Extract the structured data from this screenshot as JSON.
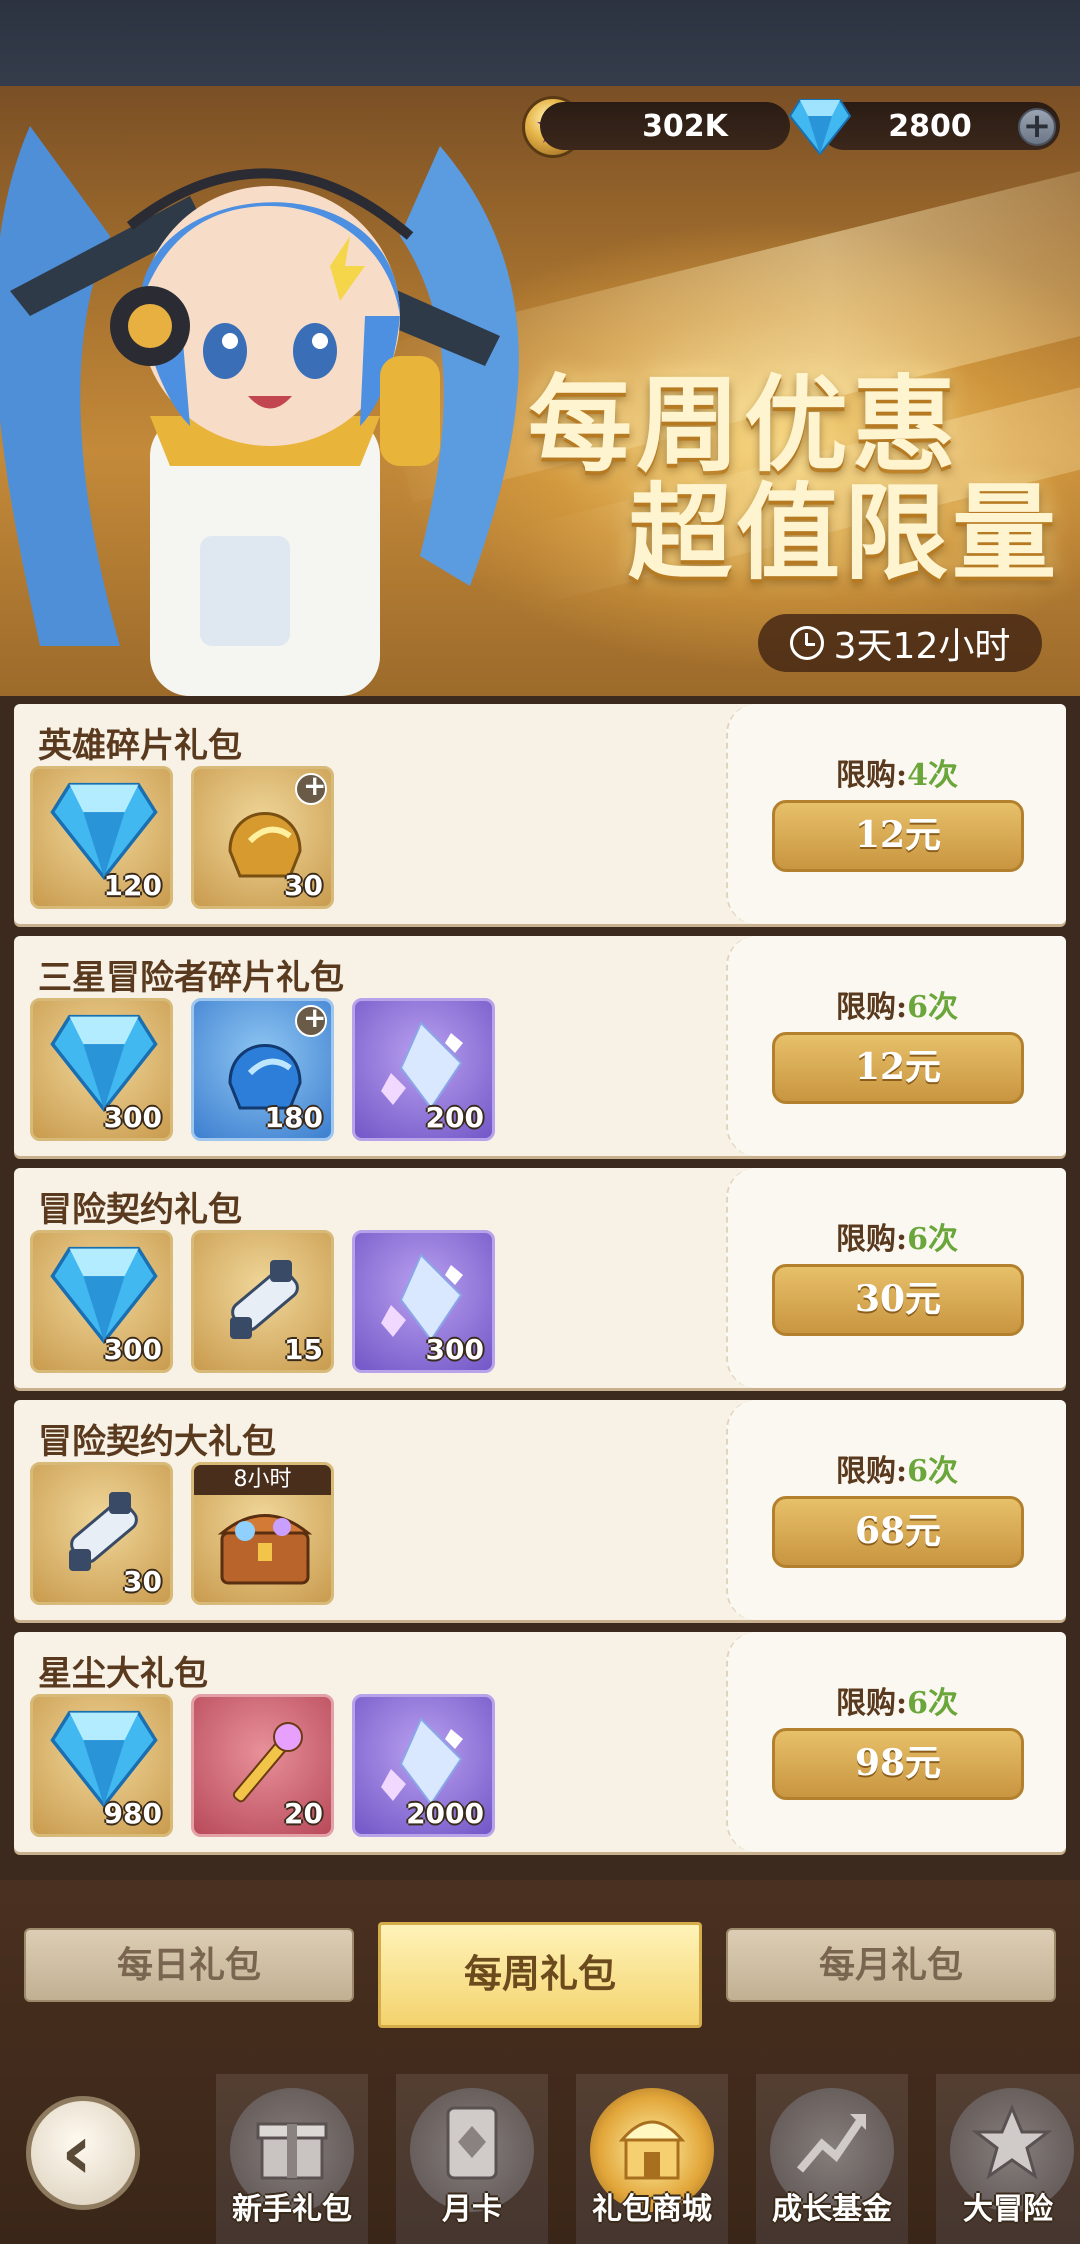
{
  "currency": {
    "gold": "302K",
    "gems": "2800",
    "add_label": "+"
  },
  "banner": {
    "line1": "每周优惠",
    "line2": "超值限量",
    "timer": "3天12小时"
  },
  "packs": [
    {
      "name": "英雄碎片礼包",
      "limit_label": "限购:",
      "limit_count": "4次",
      "price": "12元",
      "items": [
        {
          "icon": "diamond-icon",
          "qty": "120"
        },
        {
          "icon": "hero-helmet-gold-icon",
          "qty": "30"
        }
      ]
    },
    {
      "name": "三星冒险者碎片礼包",
      "limit_label": "限购:",
      "limit_count": "6次",
      "price": "12元",
      "items": [
        {
          "icon": "diamond-icon",
          "qty": "300"
        },
        {
          "icon": "hero-helmet-blue-icon",
          "qty": "180"
        },
        {
          "icon": "crystal-shards-icon",
          "qty": "200"
        }
      ]
    },
    {
      "name": "冒险契约礼包",
      "limit_label": "限购:",
      "limit_count": "6次",
      "price": "30元",
      "items": [
        {
          "icon": "diamond-icon",
          "qty": "300"
        },
        {
          "icon": "contract-scroll-icon",
          "qty": "15"
        },
        {
          "icon": "crystal-shards-icon",
          "qty": "300"
        }
      ]
    },
    {
      "name": "冒险契约大礼包",
      "limit_label": "限购:",
      "limit_count": "6次",
      "price": "68元",
      "items": [
        {
          "icon": "contract-scroll-icon",
          "qty": "30"
        },
        {
          "icon": "treasure-chest-icon",
          "tag": "8小时"
        }
      ]
    },
    {
      "name": "星尘大礼包",
      "limit_label": "限购:",
      "limit_count": "6次",
      "price": "98元",
      "items": [
        {
          "icon": "diamond-icon",
          "qty": "980"
        },
        {
          "icon": "magic-staff-icon",
          "qty": "20"
        },
        {
          "icon": "crystal-shards-icon",
          "qty": "2000"
        }
      ]
    }
  ],
  "tabs": {
    "daily": "每日礼包",
    "weekly": "每周礼包",
    "monthly": "每月礼包"
  },
  "nav": {
    "items": [
      "新手礼包",
      "月卡",
      "礼包商城",
      "成长基金",
      "大冒险"
    ]
  },
  "colors": {
    "accent_gold": "#e7c06a",
    "limit_green": "#6aa63a",
    "panel": "#f7f1e6"
  }
}
